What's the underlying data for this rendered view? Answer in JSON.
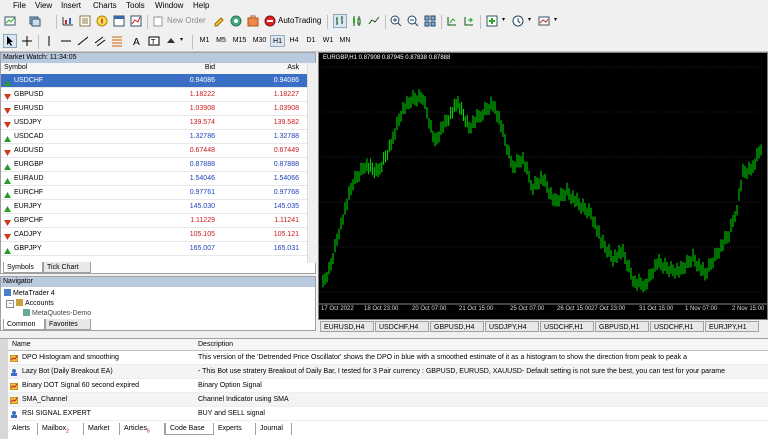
{
  "menu": [
    "File",
    "View",
    "Insert",
    "Charts",
    "Tools",
    "Window",
    "Help"
  ],
  "toolbar": {
    "new_order": "New Order",
    "autotrading": "AutoTrading"
  },
  "timeframes": [
    "M1",
    "M5",
    "M15",
    "M30",
    "H1",
    "H4",
    "D1",
    "W1",
    "MN"
  ],
  "active_timeframe": "H1",
  "market_watch": {
    "title": "Market Watch: 11:34:05",
    "columns": [
      "Symbol",
      "Bid",
      "Ask"
    ],
    "rows": [
      {
        "symbol": "USDCHF",
        "bid": "0.94086",
        "ask": "0.94086",
        "dir": "up",
        "selected": true
      },
      {
        "symbol": "GBPUSD",
        "bid": "1.18222",
        "ask": "1.18227",
        "dir": "down"
      },
      {
        "symbol": "EURUSD",
        "bid": "1.03908",
        "ask": "1.03908",
        "dir": "down"
      },
      {
        "symbol": "USDJPY",
        "bid": "139.574",
        "ask": "139.582",
        "dir": "down"
      },
      {
        "symbol": "USDCAD",
        "bid": "1.32786",
        "ask": "1.32788",
        "dir": "up"
      },
      {
        "symbol": "AUDUSD",
        "bid": "0.67448",
        "ask": "0.67449",
        "dir": "down"
      },
      {
        "symbol": "EURGBP",
        "bid": "0.87888",
        "ask": "0.87888",
        "dir": "up"
      },
      {
        "symbol": "EURAUD",
        "bid": "1.54046",
        "ask": "1.54066",
        "dir": "up"
      },
      {
        "symbol": "EURCHF",
        "bid": "0.97761",
        "ask": "0.97768",
        "dir": "up"
      },
      {
        "symbol": "EURJPY",
        "bid": "145.030",
        "ask": "145.035",
        "dir": "up"
      },
      {
        "symbol": "GBPCHF",
        "bid": "1.11229",
        "ask": "1.11241",
        "dir": "down"
      },
      {
        "symbol": "CADJPY",
        "bid": "105.105",
        "ask": "105.121",
        "dir": "down"
      },
      {
        "symbol": "GBPJPY",
        "bid": "165.007",
        "ask": "165.031",
        "dir": "up"
      }
    ],
    "tabs": [
      "Symbols",
      "Tick Chart"
    ]
  },
  "navigator": {
    "title": "Navigator",
    "items": [
      "MetaTrader 4",
      "Accounts",
      "MetaQuotes-Demo"
    ],
    "tabs": [
      "Common",
      "Favorites"
    ]
  },
  "chart": {
    "header": "EURGBP,H1  0.87908 0.87945 0.87838 0.87888",
    "x_labels": [
      "17 Oct 2022",
      "18 Oct 23:00",
      "20 Oct 07:00",
      "21 Oct 15:00",
      "25 Oct 07:00",
      "26 Oct 15:00",
      "27 Oct 23:00",
      "31 Oct 15:00",
      "1 Nov 07:00",
      "2 Nov 15:00"
    ],
    "line_color": "#00e000"
  },
  "chart_tabs": [
    "EURUSD,H4",
    "USDCHF,H4",
    "GBPUSD,H4",
    "USDJPY,H4",
    "USDCHF,H1",
    "GBPUSD,H1",
    "USDCHF,H1",
    "EURJPY,H1"
  ],
  "codebase": {
    "columns": [
      "Name",
      "Description"
    ],
    "rows": [
      {
        "name": "DPO Histogram and smoothing",
        "desc": "This version of the 'Detrended Price Oscillator' shows the DPO in blue with a smoothed estimate of it as a histogram to show the direction from peak to peak a"
      },
      {
        "name": "Lazy Bot (Daily Breakout EA)",
        "desc": "- This Bot use stratery Breakout of Daily Bar, I tested for 3 Pair currency : GBPUSD, EURUSD, XAUUSD- Default setting is not sure the best, you can test for your parame"
      },
      {
        "name": "Binary DOT Signal 60 second expired",
        "desc": "Binary Option Signal"
      },
      {
        "name": "SMA_Channel",
        "desc": "Channel Indicator using SMA"
      },
      {
        "name": "RSI SIGNAL EXPERT",
        "desc": "BUY and  SELL signal"
      }
    ]
  },
  "bottom_tabs": [
    {
      "label": "Alerts"
    },
    {
      "label": "Mailbox",
      "badge": "2"
    },
    {
      "label": "Market"
    },
    {
      "label": "Articles",
      "badge": "6"
    },
    {
      "label": "Code Base",
      "active": true
    },
    {
      "label": "Experts"
    },
    {
      "label": "Journal"
    }
  ]
}
